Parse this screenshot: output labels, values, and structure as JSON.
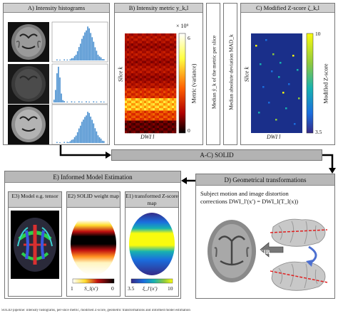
{
  "panelA": {
    "title": "A) Intensity histograms"
  },
  "panelB": {
    "title": "B) Intensity metric y_k,l",
    "colorbar_exp": "× 10⁹",
    "cb_max": "6",
    "cb_min": "0",
    "ylabel": "Slice k",
    "xlabel": "DWI l",
    "cblabel": "Metric (variance)"
  },
  "median_label": "Median ỹ_k of the metric per slice",
  "mad_label": "Median absolute deviation MAD_k",
  "panelC": {
    "title": "C) Modified Z-score ζ_k,l",
    "cb_max": "10",
    "cb_min": "3.5",
    "ylabel": "Slice k",
    "xlabel": "DWI l",
    "cblabel": "Modified Z-score"
  },
  "solid_bar": "A-C) SOLID",
  "panelE": {
    "title": "E) Informed Model Estimation",
    "e3": "E3) Model e.g. tensor",
    "e2": "E2) SOLID weight map",
    "e1": "E1) transformed Z-score map",
    "e2_min": "1",
    "e2_sym": "S_l(x′)",
    "e2_max": "0",
    "e1_min": "3.5",
    "e1_sym": "ξ_l′(x′)",
    "e1_max": "10"
  },
  "panelD": {
    "title": "D) Geometrical transformations",
    "text1": "Subject motion and image distortion",
    "text2": "corrections DWI_l′(x′) = DWI_l(T_l(x))",
    "gib": "GIB"
  },
  "caption": "SOLID pipeline: intensity histograms, per-slice metric, modified Z-score, geometric transformations and informed model estimation",
  "colors": {
    "header_gray": "#cfcfcf",
    "solid_bar": "#b3b3b3",
    "arrow": "#000000"
  }
}
